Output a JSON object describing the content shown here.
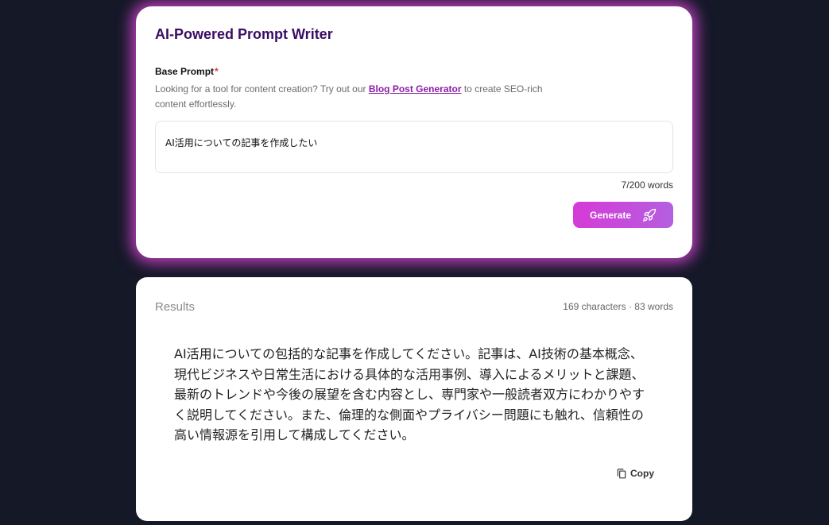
{
  "prompt_writer": {
    "title": "AI-Powered Prompt Writer",
    "base_prompt_label": "Base Prompt",
    "required_marker": "*",
    "helper_prefix": "Looking for a tool for content creation? Try out our ",
    "helper_link": "Blog Post Generator",
    "helper_suffix": " to create SEO-rich content effortlessly.",
    "input_value": "AI活用についての記事を作成したい",
    "word_count": "7/200 words",
    "generate_label": "Generate",
    "generate_icon": "rocket-icon"
  },
  "results": {
    "title": "Results",
    "stats": "169 characters · 83 words",
    "text": "AI活用についての包括的な記事を作成してください。記事は、AI技術の基本概念、現代ビジネスや日常生活における具体的な活用事例、導入によるメリットと課題、最新のトレンドや今後の展望を含む内容とし、専門家や一般読者双方にわかりやすく説明してください。また、倫理的な側面やプライバシー問題にも触れ、信頼性の高い情報源を引用して構成してください。",
    "copy_label": "Copy",
    "copy_icon": "copy-icon"
  },
  "colors": {
    "background": "#141827",
    "title": "#3a0d63",
    "accent_glow": "#d946d6",
    "button_gradient_start": "#d63ad6",
    "button_gradient_end": "#b45fe0",
    "link": "#8a1da8"
  }
}
